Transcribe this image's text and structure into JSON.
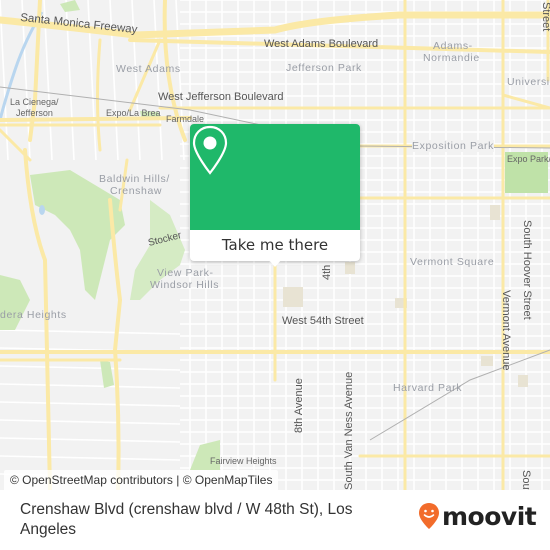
{
  "map": {
    "labels": {
      "santa_monica_freeway": "Santa Monica Freeway",
      "west_adams_boulevard": "West Adams Boulevard",
      "west_adams": "West Adams",
      "jefferson_park": "Jefferson Park",
      "adams_normandie_1": "Adams-",
      "adams_normandie_2": "Normandie",
      "university": "Universi",
      "west_jefferson_boulevard": "West Jefferson Boulevard",
      "la_cienega_1": "La Cienega/",
      "la_cienega_2": "Jefferson",
      "expo_la_brea": "Expo/La Brea",
      "farmdale": "Farmdale",
      "exposition_park": "Exposition Park",
      "expo_park_station": "Expo Park/",
      "baldwin_hills_1": "Baldwin Hills/",
      "baldwin_hills_2": "Crenshaw",
      "stocker": "Stocker",
      "view_park_1": "View Park-",
      "view_park_2": "Windsor Hills",
      "ladera_heights": "dera Heights",
      "fourth": "4th",
      "vermont_square": "Vermont Square",
      "south_hoover_street": "South Hoover Street",
      "vermont_avenue": "Vermont Avenue",
      "west_54th_street": "West 54th Street",
      "harvard_park": "Harvard Park",
      "eighth_avenue": "8th Avenue",
      "south_van_ness_avenue": "South Van Ness Avenue",
      "fairview_heights": "Fairview Heights",
      "street_top_right": "Street",
      "south_bottom_right": "South"
    },
    "popup": {
      "icon": "map-pin-icon",
      "button_label": "Take me there",
      "accent_color": "#1fb86a"
    },
    "attribution": {
      "osm": "© OpenStreetMap contributors",
      "separator": " | ",
      "omt": "© OpenMapTiles"
    }
  },
  "footer": {
    "stop_title": "Crenshaw Blvd (crenshaw blvd / W 48th St), Los Angeles",
    "logo_text": "moovit",
    "logo_color": "#f26c2b"
  }
}
